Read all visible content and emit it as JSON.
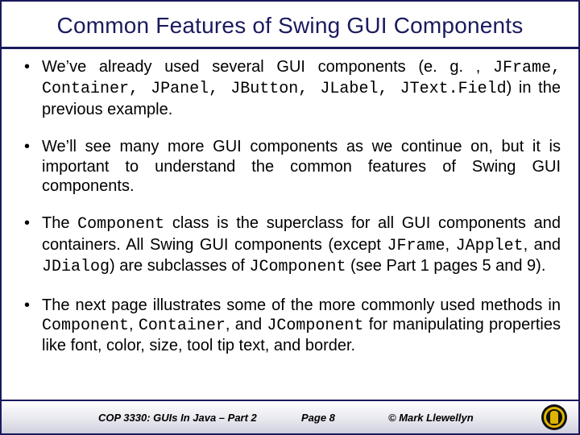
{
  "title": "Common Features of Swing GUI Components",
  "bullets": {
    "b1_a": "We’ve already used several GUI components (e. g. , ",
    "b1_c1": "JFrame, Container,  JPanel,  JButton,  JLabel, JText.Field",
    "b1_b": ") in the previous example.",
    "b2": "We’ll see many more GUI components as we continue on, but it is important to understand the common features of Swing GUI components.",
    "b3_a": "The ",
    "b3_c1": "Component",
    "b3_b": " class is the superclass for all GUI components and containers.  All Swing GUI components (except ",
    "b3_c2": "JFrame",
    "b3_c": ", ",
    "b3_c3": "JApplet",
    "b3_d": ", and ",
    "b3_c4": "JDialog",
    "b3_e": ") are subclasses of ",
    "b3_c5": "JComponent",
    "b3_f": " (see Part 1 pages 5 and 9).",
    "b4_a": "The next page illustrates some of the more commonly used methods in ",
    "b4_c1": "Component",
    "b4_b": ", ",
    "b4_c2": "Container",
    "b4_c": ", and ",
    "b4_c3": "JComponent",
    "b4_d": " for manipulating properties like font, color, size, tool tip text, and border."
  },
  "footer": {
    "course": "COP 3330:  GUIs In Java – Part 2",
    "page": "Page 8",
    "copyright": "© Mark Llewellyn"
  }
}
